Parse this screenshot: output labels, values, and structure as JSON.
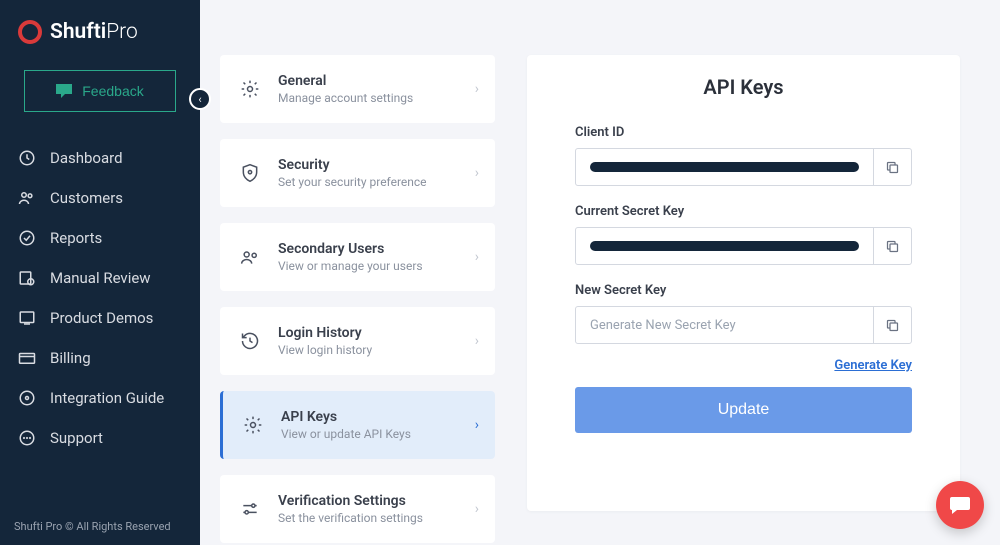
{
  "brand": {
    "name": "Shufti",
    "suffix": "Pro"
  },
  "feedback_label": "Feedback",
  "sidebar": {
    "items": [
      {
        "label": "Dashboard"
      },
      {
        "label": "Customers"
      },
      {
        "label": "Reports"
      },
      {
        "label": "Manual Review"
      },
      {
        "label": "Product Demos"
      },
      {
        "label": "Billing"
      },
      {
        "label": "Integration Guide"
      },
      {
        "label": "Support"
      }
    ],
    "footer": "Shufti Pro © All Rights Reserved"
  },
  "settings": {
    "items": [
      {
        "title": "General",
        "subtitle": "Manage account settings"
      },
      {
        "title": "Security",
        "subtitle": "Set your security preference"
      },
      {
        "title": "Secondary Users",
        "subtitle": "View or manage your users"
      },
      {
        "title": "Login History",
        "subtitle": "View login history"
      },
      {
        "title": "API Keys",
        "subtitle": "View or update API Keys"
      },
      {
        "title": "Verification Settings",
        "subtitle": "Set the verification settings"
      }
    ]
  },
  "detail": {
    "title": "API Keys",
    "fields": {
      "client_id": {
        "label": "Client ID",
        "value": "[redacted]"
      },
      "current_secret": {
        "label": "Current Secret Key",
        "value": "[redacted]"
      },
      "new_secret": {
        "label": "New Secret Key",
        "placeholder": "Generate New Secret Key"
      }
    },
    "generate_link": "Generate Key",
    "update_button": "Update"
  }
}
